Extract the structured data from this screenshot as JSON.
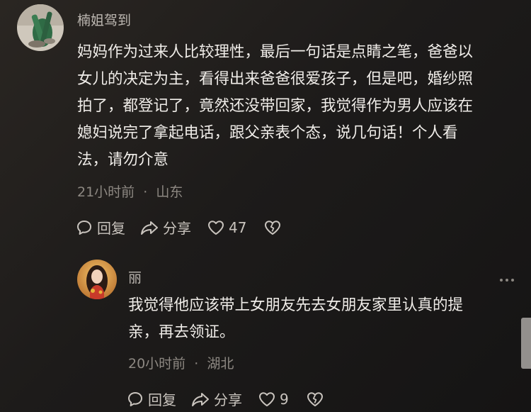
{
  "comments": [
    {
      "username": "楠姐驾到",
      "content_lines": [
        "妈妈作为过来人比较理性，最后一句话是点睛之笔，爸爸以",
        "女儿的决定为主，看得出来爸爸很爱孩子，但是吧，婚纱照",
        "拍了，都登记了，竟然还没带回家，我觉得作为男人应该在",
        "媳妇说完了拿起电话，跟父亲表个态，说几句话！个人看",
        "法，请勿介意"
      ],
      "time": "21小时前",
      "location": "山东",
      "reply_label": "回复",
      "share_label": "分享",
      "like_count": "47",
      "icons": [
        "reply-icon",
        "share-icon",
        "heart-icon",
        "broken-heart-icon"
      ]
    }
  ],
  "replies": [
    {
      "username": "丽",
      "content_lines": [
        "我觉得他应该带上女朋友先去女朋友家里认真的提",
        "亲，再去领证。"
      ],
      "time": "20小时前",
      "location": "湖北",
      "reply_label": "回复",
      "share_label": "分享",
      "like_count": "9",
      "icons": [
        "reply-icon",
        "share-icon",
        "heart-icon",
        "broken-heart-icon",
        "more-icon"
      ]
    }
  ],
  "meta_separator": "·",
  "colors": {
    "background": "#1d1b1a",
    "text": "#f0ede9",
    "muted": "#8d8882",
    "username": "#bdb8b2"
  }
}
